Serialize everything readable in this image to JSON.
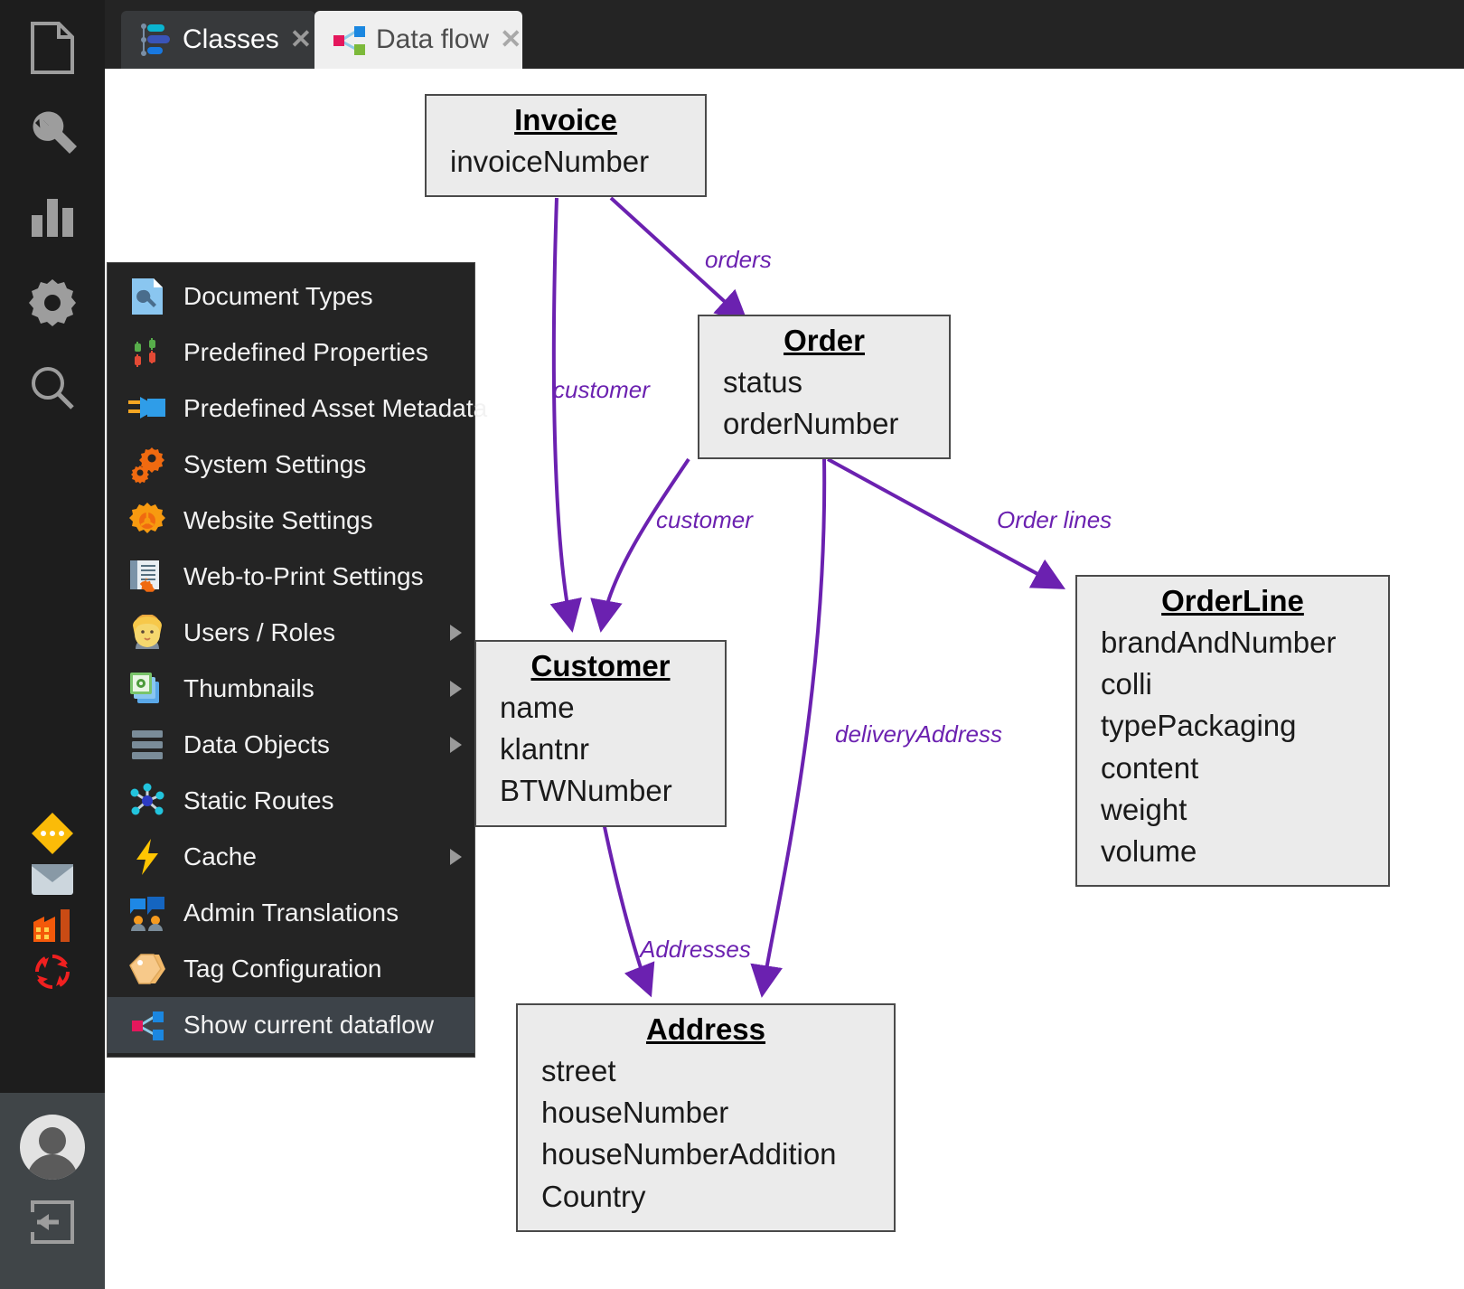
{
  "app": {
    "rail_top_icons": [
      {
        "name": "document-icon"
      },
      {
        "name": "wrench-icon"
      },
      {
        "name": "bar-chart-icon"
      },
      {
        "name": "gear-icon"
      },
      {
        "name": "search-icon"
      }
    ],
    "rail_mid_icons": [
      {
        "name": "diamond-more-icon"
      },
      {
        "name": "envelope-icon"
      },
      {
        "name": "factory-icon"
      },
      {
        "name": "refresh-icon"
      }
    ],
    "rail_bottom_icons": [
      {
        "name": "avatar"
      },
      {
        "name": "logout-icon"
      }
    ]
  },
  "tabs": [
    {
      "label": "Classes",
      "icon": "classes-icon",
      "close": "✕",
      "active": false
    },
    {
      "label": "Data flow",
      "icon": "dataflow-icon",
      "close": "✕",
      "active": true
    }
  ],
  "context_menu": {
    "items": [
      {
        "label": "Document Types",
        "icon": "document-types-icon",
        "submenu": false,
        "active": false
      },
      {
        "label": "Predefined Properties",
        "icon": "predefined-properties-icon",
        "submenu": false,
        "active": false
      },
      {
        "label": "Predefined Asset Metadata",
        "icon": "predefined-asset-metadata-icon",
        "submenu": false,
        "active": false
      },
      {
        "label": "System Settings",
        "icon": "system-settings-icon",
        "submenu": false,
        "active": false
      },
      {
        "label": "Website Settings",
        "icon": "website-settings-icon",
        "submenu": false,
        "active": false
      },
      {
        "label": "Web-to-Print Settings",
        "icon": "web-to-print-settings-icon",
        "submenu": false,
        "active": false
      },
      {
        "label": "Users / Roles",
        "icon": "users-roles-icon",
        "submenu": true,
        "active": false
      },
      {
        "label": "Thumbnails",
        "icon": "thumbnails-icon",
        "submenu": true,
        "active": false
      },
      {
        "label": "Data Objects",
        "icon": "data-objects-icon",
        "submenu": true,
        "active": false
      },
      {
        "label": "Static Routes",
        "icon": "static-routes-icon",
        "submenu": false,
        "active": false
      },
      {
        "label": "Cache",
        "icon": "cache-icon",
        "submenu": true,
        "active": false
      },
      {
        "label": "Admin Translations",
        "icon": "admin-translations-icon",
        "submenu": false,
        "active": false
      },
      {
        "label": "Tag Configuration",
        "icon": "tag-configuration-icon",
        "submenu": false,
        "active": false
      },
      {
        "label": "Show current dataflow",
        "icon": "dataflow-icon",
        "submenu": false,
        "active": true
      }
    ]
  },
  "diagram": {
    "edge_color": "#6b21b0",
    "node_fill": "#ebebeb",
    "node_border": "#4a4a4a",
    "nodes": [
      {
        "id": "invoice",
        "title": "Invoice",
        "attributes": [
          "invoiceNumber"
        ]
      },
      {
        "id": "order",
        "title": "Order",
        "attributes": [
          "status",
          "orderNumber"
        ]
      },
      {
        "id": "customer",
        "title": "Customer",
        "attributes": [
          "name",
          "klantnr",
          "BTWNumber"
        ]
      },
      {
        "id": "orderline",
        "title": "OrderLine",
        "attributes": [
          "brandAndNumber",
          "colli",
          "typePackaging",
          "content",
          "weight",
          "volume"
        ]
      },
      {
        "id": "address",
        "title": "Address",
        "attributes": [
          "street",
          "houseNumber",
          "houseNumberAddition",
          "Country"
        ]
      }
    ],
    "edges": [
      {
        "from": "invoice",
        "to": "order",
        "label": "orders"
      },
      {
        "from": "invoice",
        "to": "customer",
        "label": "customer"
      },
      {
        "from": "order",
        "to": "customer",
        "label": "customer"
      },
      {
        "from": "order",
        "to": "orderline",
        "label": "Order lines"
      },
      {
        "from": "order",
        "to": "address",
        "label": "deliveryAddress"
      },
      {
        "from": "customer",
        "to": "address",
        "label": "Addresses"
      }
    ]
  }
}
